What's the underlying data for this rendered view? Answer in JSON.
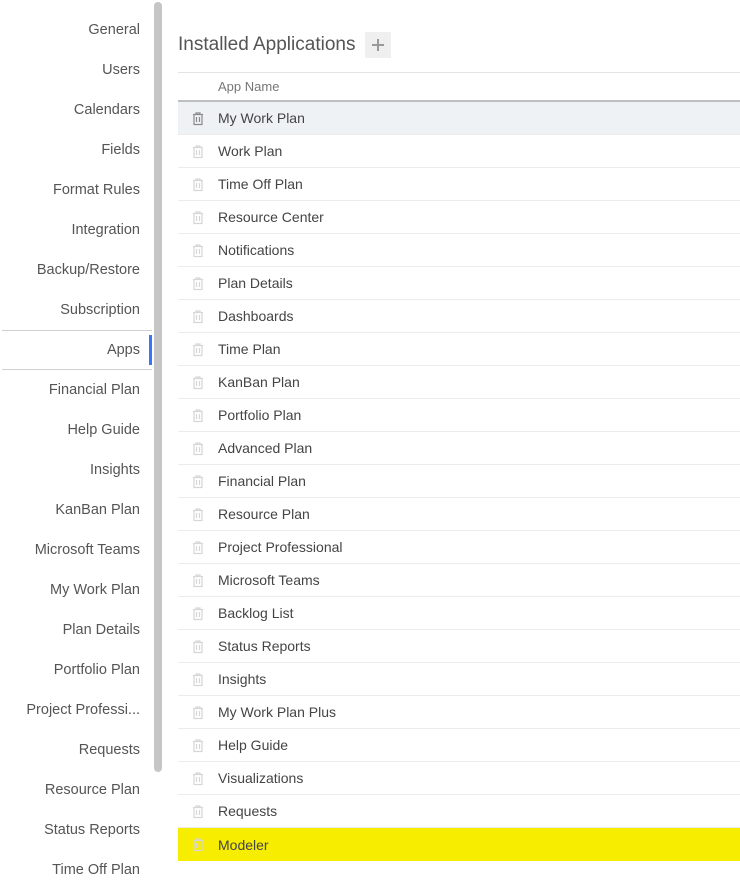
{
  "sidebar": {
    "items": [
      {
        "label": "General"
      },
      {
        "label": "Users"
      },
      {
        "label": "Calendars"
      },
      {
        "label": "Fields"
      },
      {
        "label": "Format Rules"
      },
      {
        "label": "Integration"
      },
      {
        "label": "Backup/Restore"
      },
      {
        "label": "Subscription"
      },
      {
        "label": "Apps",
        "active": true
      },
      {
        "label": "Financial Plan"
      },
      {
        "label": "Help Guide"
      },
      {
        "label": "Insights"
      },
      {
        "label": "KanBan Plan"
      },
      {
        "label": "Microsoft Teams"
      },
      {
        "label": "My Work Plan"
      },
      {
        "label": "Plan Details"
      },
      {
        "label": "Portfolio Plan"
      },
      {
        "label": "Project Professi..."
      },
      {
        "label": "Requests"
      },
      {
        "label": "Resource Plan"
      },
      {
        "label": "Status Reports"
      },
      {
        "label": "Time Off Plan"
      }
    ]
  },
  "main": {
    "title": "Installed Applications",
    "column_header": "App Name",
    "rows": [
      {
        "name": "My Work Plan",
        "selected": true
      },
      {
        "name": "Work Plan"
      },
      {
        "name": "Time Off Plan"
      },
      {
        "name": "Resource Center"
      },
      {
        "name": "Notifications"
      },
      {
        "name": "Plan Details"
      },
      {
        "name": "Dashboards"
      },
      {
        "name": "Time Plan"
      },
      {
        "name": "KanBan Plan"
      },
      {
        "name": "Portfolio Plan"
      },
      {
        "name": "Advanced Plan"
      },
      {
        "name": "Financial Plan"
      },
      {
        "name": "Resource Plan"
      },
      {
        "name": "Project Professional"
      },
      {
        "name": "Microsoft Teams"
      },
      {
        "name": "Backlog List"
      },
      {
        "name": "Status Reports"
      },
      {
        "name": "Insights"
      },
      {
        "name": "My Work Plan Plus"
      },
      {
        "name": "Help Guide"
      },
      {
        "name": "Visualizations"
      },
      {
        "name": "Requests"
      },
      {
        "name": "Modeler",
        "highlight": true
      }
    ]
  }
}
